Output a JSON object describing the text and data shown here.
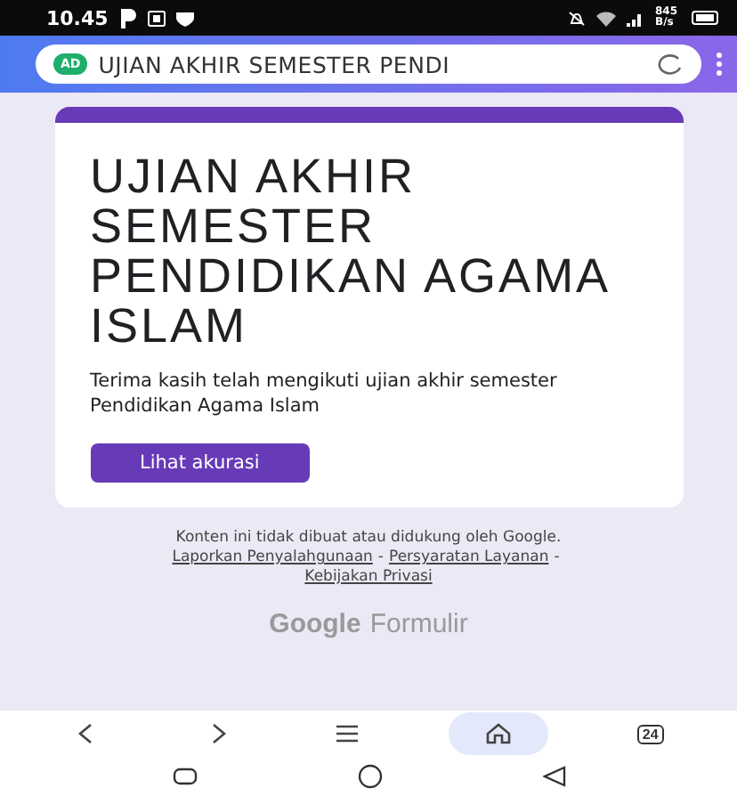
{
  "status_bar": {
    "time": "10.45",
    "speed": "845 B/s"
  },
  "browser": {
    "site_badge": "AD",
    "title": "UJIAN AKHIR SEMESTER PENDI"
  },
  "card": {
    "title": "UJIAN AKHIR SEMESTER PENDIDIKAN AGAMA ISLAM",
    "message": "Terima kasih telah mengikuti ujian akhir semester Pendidikan Agama Islam",
    "button": "Lihat akurasi"
  },
  "footer": {
    "disclaimer": "Konten ini tidak dibuat atau didukung oleh Google.",
    "links": [
      "Laporkan Penyalahgunaan",
      "Persyaratan Layanan",
      "Kebijakan Privasi"
    ],
    "separator": "-",
    "brand": "Google",
    "product": "Formulir"
  },
  "nav": {
    "tab_count": "24",
    "items": [
      {
        "kind": "back",
        "selected": false
      },
      {
        "kind": "forward",
        "selected": false
      },
      {
        "kind": "menu",
        "selected": false
      },
      {
        "kind": "home",
        "selected": true
      },
      {
        "kind": "tabs",
        "selected": false
      }
    ]
  }
}
